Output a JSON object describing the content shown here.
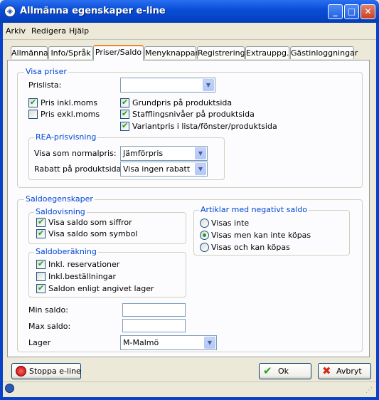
{
  "window": {
    "title": "Allmänna egenskaper e-line"
  },
  "menu": [
    "Arkiv",
    "Redigera",
    "Hjälp"
  ],
  "tabs": [
    "Allmänna",
    "Info/Språk",
    "Priser/Saldo",
    "Menyknappar",
    "Registrering",
    "Extrauppg.",
    "Gästinloggningar"
  ],
  "active_tab": "Priser/Saldo",
  "visa_priser": {
    "legend": "Visa priser",
    "prislista_label": "Prislista:",
    "prislista_value": "",
    "pris_inkl_moms": {
      "label": "Pris inkl.moms",
      "checked": true
    },
    "pris_exkl_moms": {
      "label": "Pris exkl.moms",
      "checked": false
    },
    "grundpris": {
      "label": "Grundpris på produktsida",
      "checked": true
    },
    "stafflingsnivaer": {
      "label": "Stafflingsnivåer på produktsida",
      "checked": true
    },
    "variantpris": {
      "label": "Variantpris i lista/fönster/produktsida",
      "checked": true
    },
    "rea": {
      "legend": "REA-prisvisning",
      "normalpris_label": "Visa som normalpris:",
      "normalpris_value": "Jämförpris",
      "rabatt_label": "Rabatt på produktsida:",
      "rabatt_value": "Visa ingen rabatt"
    }
  },
  "saldo": {
    "legend": "Saldoegenskaper",
    "saldovisning": {
      "legend": "Saldovisning",
      "siffror": {
        "label": "Visa saldo som siffror",
        "checked": true
      },
      "symbol": {
        "label": "Visa saldo som symbol",
        "checked": true
      }
    },
    "saldoberakning": {
      "legend": "Saldoberäkning",
      "reservationer": {
        "label": "Inkl. reservationer",
        "checked": true
      },
      "bestallningar": {
        "label": "Inkl.beställningar",
        "checked": false
      },
      "lager": {
        "label": "Saldon enligt angivet lager",
        "checked": true
      }
    },
    "negativt": {
      "legend": "Artiklar med negativt saldo",
      "options": [
        "Visas inte",
        "Visas men kan inte köpas",
        "Visas och kan köpas"
      ],
      "selected": 1
    },
    "min_saldo_label": "Min saldo:",
    "min_saldo_value": "",
    "max_saldo_label": "Max saldo:",
    "max_saldo_value": "",
    "lager_label": "Lager",
    "lager_value": "M-Malmö"
  },
  "buttons": {
    "stop": "Stoppa e-line",
    "ok": "Ok",
    "cancel": "Avbryt"
  },
  "colors": {
    "titlebar": "#0542c4",
    "legend": "#0046d5",
    "tab_highlight": "#e68b2c",
    "check": "#21a121",
    "cancel_x": "#d32a1b"
  }
}
